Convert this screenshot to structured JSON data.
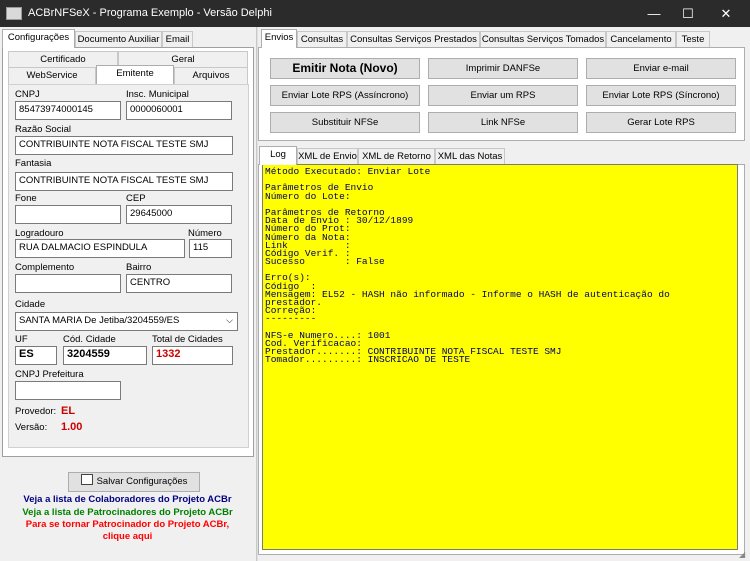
{
  "window": {
    "title": "ACBrNFSeX - Programa Exemplo - Versão Delphi",
    "minimize": "—",
    "maximize": "☐",
    "close": "✕"
  },
  "left_tabs": [
    "Configurações",
    "Documento Auxiliar",
    "Email"
  ],
  "sub_tabs_row1": [
    "Certificado",
    "Geral"
  ],
  "sub_tabs_row2": [
    "WebService",
    "Emitente",
    "Arquivos"
  ],
  "emitente": {
    "cnpj_label": "CNPJ",
    "cnpj": "85473974000145",
    "im_label": "Insc. Municipal",
    "im": "0000060001",
    "razao_label": "Razão Social",
    "razao": "CONTRIBUINTE NOTA FISCAL TESTE SMJ",
    "fantasia_label": "Fantasia",
    "fantasia": "CONTRIBUINTE NOTA FISCAL TESTE SMJ",
    "fone_label": "Fone",
    "fone": "",
    "cep_label": "CEP",
    "cep": "29645000",
    "logradouro_label": "Logradouro",
    "logradouro": "RUA DALMACIO ESPINDULA",
    "numero_label": "Número",
    "numero": "115",
    "complemento_label": "Complemento",
    "complemento": "",
    "bairro_label": "Bairro",
    "bairro": "CENTRO",
    "cidade_label": "Cidade",
    "cidade": "SANTA MARIA De Jetiba/3204559/ES",
    "uf_label": "UF",
    "uf": "ES",
    "cod_cidade_label": "Cód. Cidade",
    "cod_cidade": "3204559",
    "total_cidades_label": "Total de Cidades",
    "total_cidades": "1332",
    "cnpj_prefeitura_label": "CNPJ Prefeitura",
    "cnpj_prefeitura": "",
    "provedor_label": "Provedor:",
    "provedor": "EL",
    "versao_label": "Versão:",
    "versao": "1.00"
  },
  "save_button": "Salvar Configurações",
  "links": {
    "colaboradores": "Veja a lista de Colaboradores do Projeto ACBr",
    "patrocinadores": "Veja a lista de Patrocinadores do Projeto ACBr",
    "patrocinar_1": "Para se tornar Patrocinador do Projeto ACBr,",
    "patrocinar_2": "clique aqui"
  },
  "right_tabs": [
    "Envios",
    "Consultas",
    "Consultas Serviços Prestados",
    "Consultas Serviços Tomados",
    "Cancelamento",
    "Teste"
  ],
  "buttons": [
    "Emitir Nota (Novo)",
    "Imprimir DANFSe",
    "Enviar e-mail",
    "Enviar Lote RPS (Assíncrono)",
    "Enviar um RPS",
    "Enviar Lote RPS (Síncrono)",
    "Substituir NFSe",
    "Link NFSe",
    "Gerar Lote RPS"
  ],
  "log_tabs": [
    "Log",
    "XML de Envio",
    "XML de Retorno",
    "XML das Notas"
  ],
  "log_lines": [
    "Método Executado: Enviar Lote",
    "",
    "Parâmetros de Envio",
    "Número do Lote:",
    "",
    "Parâmetros de Retorno",
    "Data de Envio : 30/12/1899",
    "Número do Prot:",
    "Número da Nota:",
    "Link          :",
    "Código Verif. :",
    "Sucesso       : False",
    "",
    "Erro(s):",
    "Código  :",
    "Mensagem: EL52 - HASH não informado - Informe o HASH de autenticação do",
    "prestador.",
    "Correção:",
    "---------",
    "",
    "NFS-e Numero....: 1001",
    "Cod. Verificacao:",
    "Prestador.......: CONTRIBUINTE NOTA FISCAL TESTE SMJ",
    "Tomador.........: INSCRICAO DE TESTE"
  ],
  "colors": {
    "log_bg": "#ffff00",
    "link_blue": "#000080",
    "link_green": "#008000",
    "link_red": "#ff0000",
    "value_red": "#cc0000"
  }
}
